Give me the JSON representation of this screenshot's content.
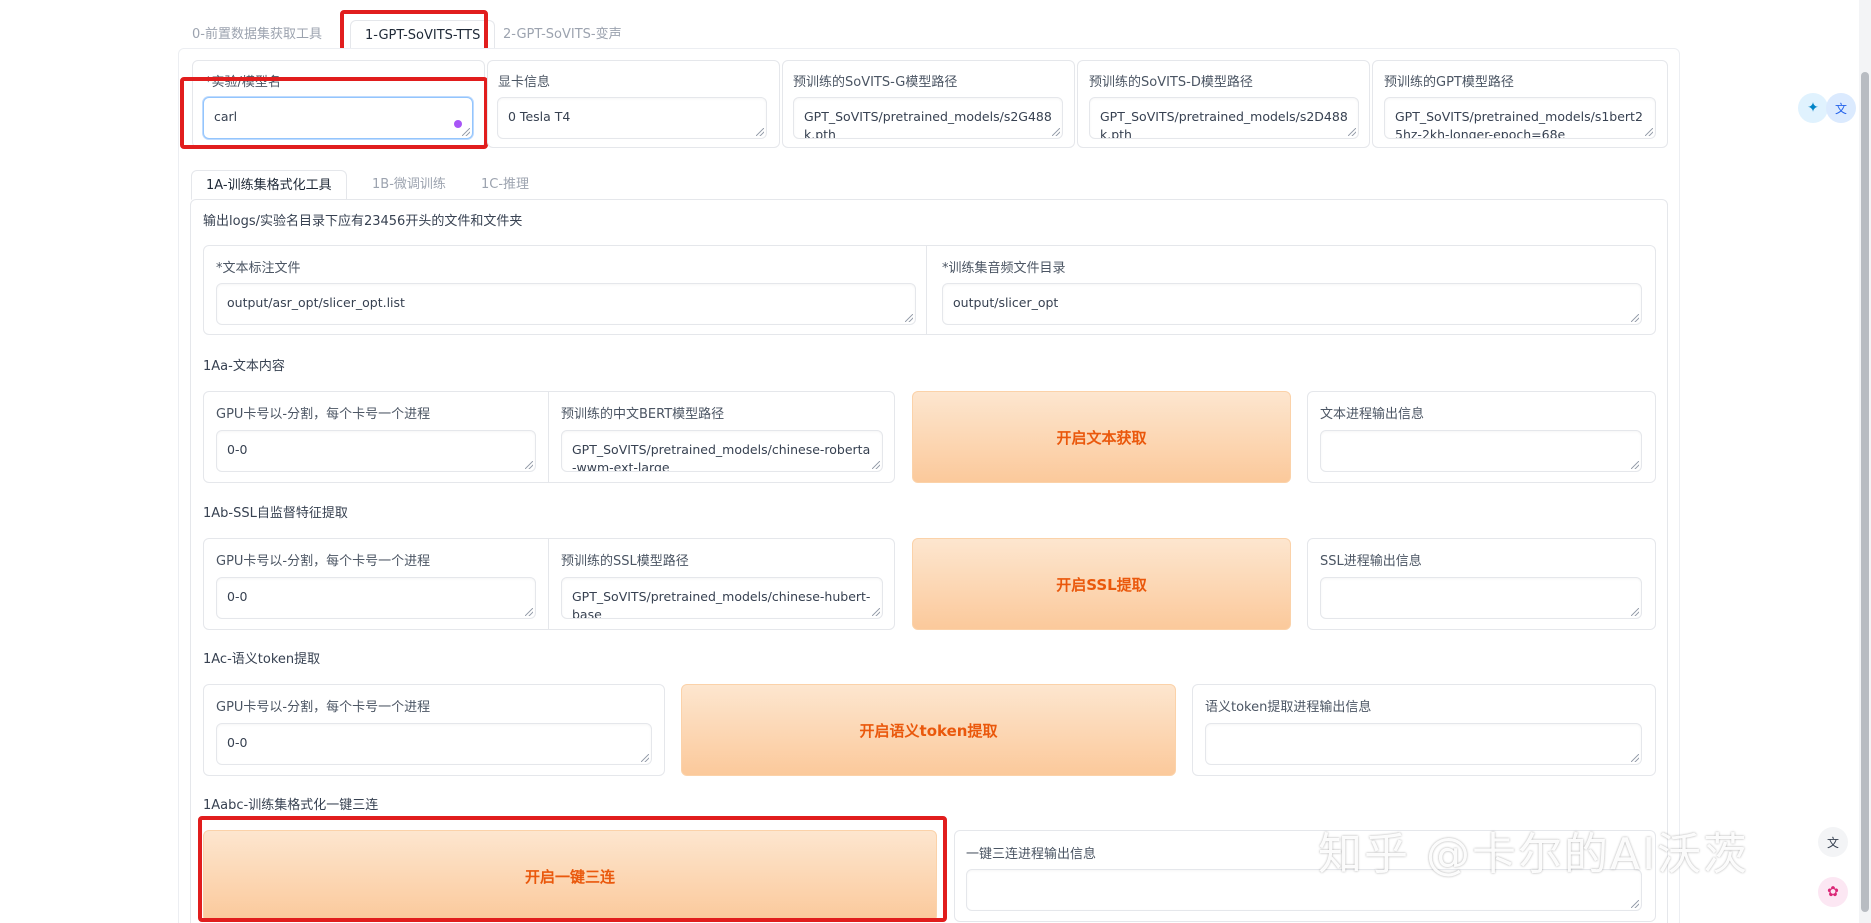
{
  "tabs": [
    {
      "label": "0-前置数据集获取工具"
    },
    {
      "label": "1-GPT-SoVITS-TTS"
    },
    {
      "label": "2-GPT-SoVITS-变声"
    }
  ],
  "top_fields": {
    "exp_name": {
      "label": "*实验/模型名",
      "value": "carl"
    },
    "gpu_info": {
      "label": "显卡信息",
      "value": "0 Tesla T4"
    },
    "sovits_g": {
      "label": "预训练的SoVITS-G模型路径",
      "value": "GPT_SoVITS/pretrained_models/s2G488k.pth"
    },
    "sovits_d": {
      "label": "预训练的SoVITS-D模型路径",
      "value": "GPT_SoVITS/pretrained_models/s2D488k.pth"
    },
    "gpt_path": {
      "label": "预训练的GPT模型路径",
      "value": "GPT_SoVITS/pretrained_models/s1bert25hz-2kh-longer-epoch=68e"
    }
  },
  "sub_tabs": [
    {
      "label": "1A-训练集格式化工具"
    },
    {
      "label": "1B-微调训练"
    },
    {
      "label": "1C-推理"
    }
  ],
  "intro_text": "输出logs/实验名目录下应有23456开头的文件和文件夹",
  "dataset": {
    "list_label": "*文本标注文件",
    "list_value": "output/asr_opt/slicer_opt.list",
    "wav_label": "*训练集音频文件目录",
    "wav_value": "output/slicer_opt"
  },
  "sec_1a": {
    "title": "1Aa-文本内容",
    "gpu_label": "GPU卡号以-分割，每个卡号一个进程",
    "gpu_value": "0-0",
    "bert_label": "预训练的中文BERT模型路径",
    "bert_value": "GPT_SoVITS/pretrained_models/chinese-roberta-wwm-ext-large",
    "button": "开启文本获取",
    "output_label": "文本进程输出信息",
    "output_value": ""
  },
  "sec_1b": {
    "title": "1Ab-SSL自监督特征提取",
    "gpu_label": "GPU卡号以-分割，每个卡号一个进程",
    "gpu_value": "0-0",
    "ssl_label": "预训练的SSL模型路径",
    "ssl_value": "GPT_SoVITS/pretrained_models/chinese-hubert-base",
    "button": "开启SSL提取",
    "output_label": "SSL进程输出信息",
    "output_value": ""
  },
  "sec_1c": {
    "title": "1Ac-语义token提取",
    "gpu_label": "GPU卡号以-分割，每个卡号一个进程",
    "gpu_value": "0-0",
    "button": "开启语义token提取",
    "output_label": "语义token提取进程输出信息",
    "output_value": ""
  },
  "sec_1abc": {
    "title": "1Aabc-训练集格式化一键三连",
    "button": "开启一键三连",
    "output_label": "一键三连进程输出信息",
    "output_value": ""
  },
  "watermark": "知乎 @卡尔的AI沃茨"
}
